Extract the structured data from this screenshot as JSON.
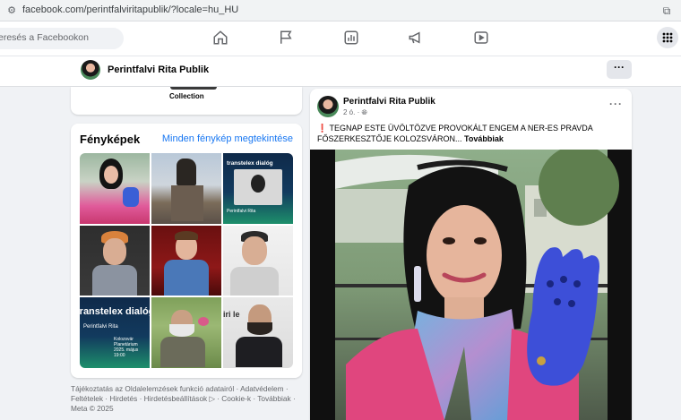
{
  "browser": {
    "url": "facebook.com/perintfalviritapublik/?locale=hu_HU"
  },
  "nav": {
    "search_placeholder": "eresés a Facebookon",
    "icons": [
      "home-icon",
      "flag-icon",
      "dashboard-icon",
      "megaphone-icon",
      "video-icon",
      "apps-grid-icon"
    ]
  },
  "page": {
    "name": "Perintfalvi Rita Publik",
    "more_label": "···"
  },
  "collection": {
    "label": "Collection"
  },
  "photos": {
    "title": "Fényképek",
    "see_all": "Minden fénykép megtekintése",
    "items": [
      {
        "caption": ""
      },
      {
        "caption": ""
      },
      {
        "caption": "transtelex dialóg",
        "subcaption": "Perintfalvi Rita"
      },
      {
        "caption": ""
      },
      {
        "caption": ""
      },
      {
        "caption": ""
      },
      {
        "caption": "transtelex dialóg",
        "subcaption": "Perintfalvi Rita",
        "lines": [
          "Kolozsvár",
          "Planetárium",
          "2025. május",
          "19:00"
        ]
      },
      {
        "caption": ""
      },
      {
        "caption": "iri le"
      }
    ]
  },
  "footer": {
    "links": [
      "Tájékoztatás az Oldalelemzések funkció adatairól",
      "Adatvédelem",
      "Feltételek",
      "Hirdetés",
      "Hirdetésbeállítások",
      "Cookie-k",
      "Továbbiak",
      "Meta © 2025"
    ]
  },
  "post": {
    "author": "Perintfalvi Rita Publik",
    "time": "2 ó.",
    "dots": "···",
    "text": "❗ TEGNAP ESTE ÜVÖLTÖZVE PROVOKÁLT ENGEM A NER-ES PRAVDA FŐSZERKESZTŐJE KOLOZSVÁRON...",
    "see_more": "Továbbiak"
  },
  "colors": {
    "accent": "#1877f2",
    "background": "#f0f2f5"
  }
}
